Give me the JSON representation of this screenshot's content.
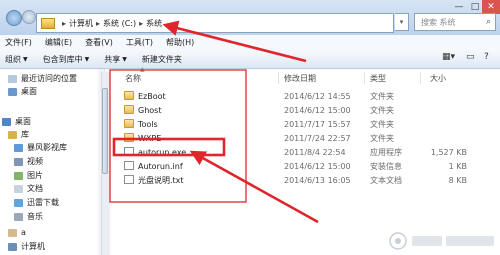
{
  "address_bar": {
    "segments": [
      "计算机",
      "系统 (C:)",
      "系统"
    ],
    "dropdown_icon": "chevron-down-icon",
    "search_placeholder": "搜索 系统",
    "search_icon": "magnifier-icon"
  },
  "menu": {
    "items": [
      "文件(F)",
      "编辑(E)",
      "查看(V)",
      "工具(T)",
      "帮助(H)"
    ]
  },
  "toolbar": {
    "organize": "组织",
    "include_in_library": "包含到库中",
    "share": "共享",
    "new_folder": "新建文件夹"
  },
  "nav_pane": {
    "items": [
      {
        "label": "最近访问的位置",
        "icon": "recent-places-icon"
      },
      {
        "label": "桌面",
        "icon": "desktop-icon"
      },
      {
        "label": "桌面",
        "icon": "desktop-icon"
      },
      {
        "label": "库",
        "icon": "library-icon"
      },
      {
        "label": "暴风影视库",
        "icon": "video-library-icon"
      },
      {
        "label": "视频",
        "icon": "video-icon"
      },
      {
        "label": "图片",
        "icon": "pictures-icon"
      },
      {
        "label": "文档",
        "icon": "documents-icon"
      },
      {
        "label": "迅雷下载",
        "icon": "download-icon"
      },
      {
        "label": "音乐",
        "icon": "music-icon"
      },
      {
        "label": "a",
        "icon": "user-icon"
      },
      {
        "label": "计算机",
        "icon": "computer-icon"
      }
    ]
  },
  "columns": {
    "name": "名称",
    "date": "修改日期",
    "type": "类型",
    "size": "大小"
  },
  "files": [
    {
      "name": "EzBoot",
      "date": "2014/6/12 14:55",
      "type": "文件夹",
      "size": "",
      "icon": "folder-icon"
    },
    {
      "name": "Ghost",
      "date": "2014/6/12 15:00",
      "type": "文件夹",
      "size": "",
      "icon": "folder-icon"
    },
    {
      "name": "Tools",
      "date": "2011/7/17 15:57",
      "type": "文件夹",
      "size": "",
      "icon": "folder-icon"
    },
    {
      "name": "WXPE",
      "date": "2011/7/24 22:57",
      "type": "文件夹",
      "size": "",
      "icon": "folder-icon"
    },
    {
      "name": "autorun.exe",
      "date": "2011/8/4 22:54",
      "type": "应用程序",
      "size": "1,527 KB",
      "icon": "exe-icon"
    },
    {
      "name": "Autorun.inf",
      "date": "2014/6/12 15:00",
      "type": "安装信息",
      "size": "1 KB",
      "icon": "inf-icon"
    },
    {
      "name": "光盘说明.txt",
      "date": "2014/6/13 16:05",
      "type": "文本文档",
      "size": "8 KB",
      "icon": "text-file-icon"
    }
  ],
  "colors": {
    "annotation_red": "#e0252b",
    "title_gradient_top": "#d6e4f3",
    "title_gradient_bottom": "#bcd3ec"
  }
}
